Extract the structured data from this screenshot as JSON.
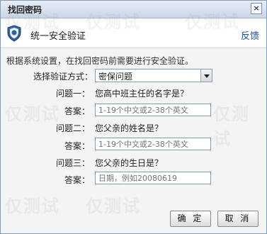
{
  "window": {
    "title": "找回密码",
    "close_icon": "close-icon"
  },
  "header": {
    "title": "统一安全验证",
    "feedback": "反馈",
    "icon": "shield-icon"
  },
  "intro": "根据系统设置，在找回密码前需要进行安全验证。",
  "method": {
    "label": "选择验证方式：",
    "value": "密保问题"
  },
  "questions": [
    {
      "q_label": "问题一：",
      "q_text": "您高中班主任的名字是？",
      "a_label": "答案：",
      "placeholder": "1-19个中文或2-38个英文"
    },
    {
      "q_label": "问题二：",
      "q_text": "您父亲的姓名是？",
      "a_label": "答案：",
      "placeholder": "1-19个中文或2-38个英文"
    },
    {
      "q_label": "问题三：",
      "q_text": "您父亲的生日是？",
      "a_label": "答案：",
      "placeholder": "日期，例如20080619"
    }
  ],
  "buttons": {
    "ok": "确 定",
    "cancel": "取 消"
  },
  "watermark": "仅测试"
}
